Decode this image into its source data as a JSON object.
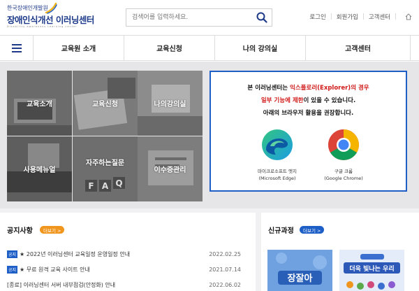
{
  "header": {
    "logo_small": "한국장애인개발원",
    "logo_main_1": "장애인식개선",
    "logo_main_2": "이러닝센터",
    "logo_sub": "Disability awareness Learning center",
    "search_placeholder": "검색어를 입력하세요.",
    "util_links": [
      "로그인",
      "회원가입",
      "고객센터"
    ],
    "icons": {
      "search": "search-icon",
      "home": "home-icon",
      "menu": "hamburger-menu-icon"
    }
  },
  "gnb": {
    "items": [
      "교육원 소개",
      "교육신청",
      "나의 강의실",
      "고객센터"
    ]
  },
  "tiles": [
    "교육소개",
    "교육신청",
    "나의강의실",
    "사용메뉴얼",
    "자주하는질문",
    "이수증관리"
  ],
  "browser_notice": {
    "line1_pre": "본 이러닝센터는 ",
    "line1_red": "익스플로러(Explorer)의 경우",
    "line2_red": "일부 기능에 제한",
    "line2_post": "이 있을 수 있습니다.",
    "line3": "아래의 브라우저 활용을 권장합니다.",
    "edge_name": "마이크로소프트 엣지",
    "edge_sub": "(Microsoft Edge)",
    "chrome_name": "구글 크롬",
    "chrome_sub": "(Google Chrome)"
  },
  "notices": {
    "title": "공지사항",
    "more": "더보기 >",
    "posts": [
      {
        "tag": "공지",
        "title": "★ 2022년 이러닝센터 교육일정 운영일정 안내",
        "date": "2022.02.25"
      },
      {
        "tag": "공지",
        "title": "★ 무료 원격 교육 사이트 안내",
        "date": "2021.07.14"
      },
      {
        "tag": "",
        "title": "[종료] 이러닝센터 서버 내부점검(안정화) 안내",
        "date": "2022.06.02"
      }
    ]
  },
  "new_courses": {
    "title": "신규과정",
    "more": "더보기 >",
    "thumb1_text": "장잘아",
    "thumb2_text": "더욱 빛나는 우리"
  },
  "colors": {
    "brand": "#1d3a8a",
    "accent_blue": "#1d5fc7",
    "accent_orange": "#f0961e",
    "warning_red": "#d11a1a"
  }
}
